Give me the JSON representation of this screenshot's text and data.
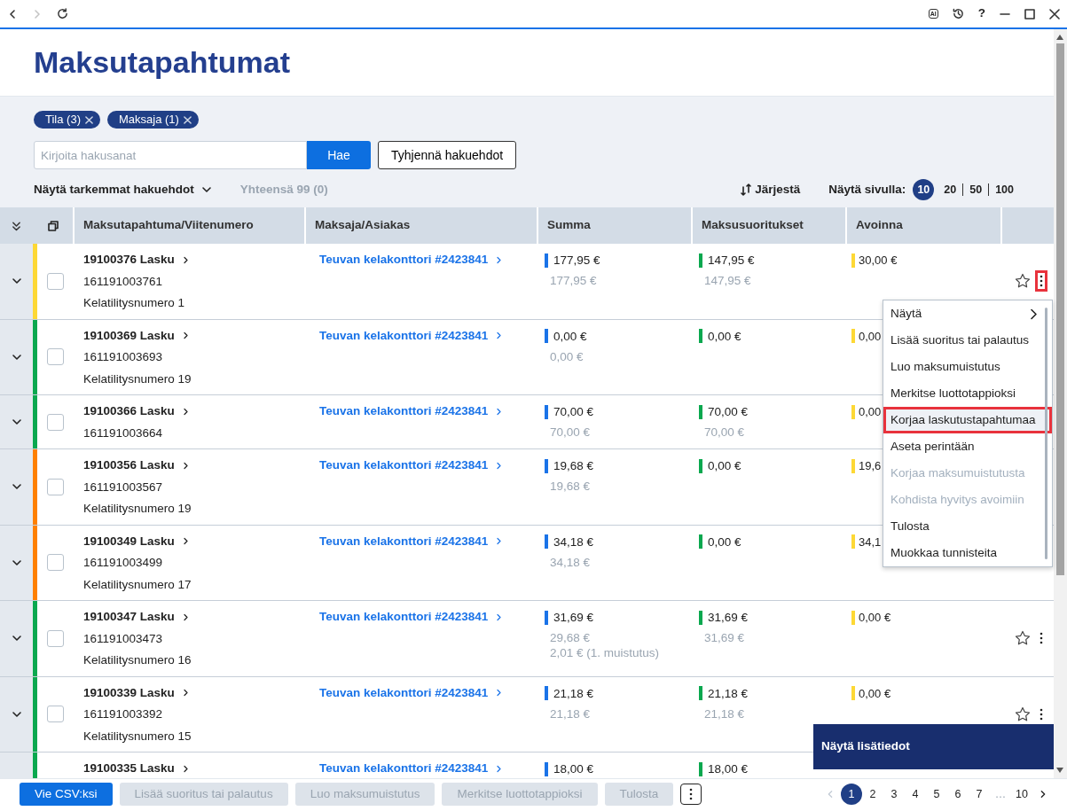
{
  "browser": {
    "ai_label": "AI",
    "help_label": "?"
  },
  "title": "Maksutapahtumat",
  "filters": [
    {
      "label": "Tila (3)"
    },
    {
      "label": "Maksaja (1)"
    }
  ],
  "search": {
    "placeholder": "Kirjoita hakusanat",
    "button": "Hae",
    "clear": "Tyhjennä hakuehdot"
  },
  "advanced": "Näytä tarkemmat hakuehdot",
  "total": "Yhteensä 99 (0)",
  "sort": "Järjestä",
  "per_page": {
    "label": "Näytä sivulla:",
    "options": [
      {
        "label": "10",
        "selected": true
      },
      {
        "label": "20",
        "selected": false
      },
      {
        "label": "50",
        "selected": false
      },
      {
        "label": "100",
        "selected": false
      }
    ]
  },
  "table": {
    "columns": [
      "Maksutapahtuma/Viitenumero",
      "Maksaja/Asiakas",
      "Summa",
      "Maksusuoritukset",
      "Avoinna"
    ],
    "rows": [
      {
        "invoice": "19100376 Lasku",
        "reference": "161191003761",
        "note": "Kelatilitysnumero 1",
        "color": "#fdd835",
        "checked": false,
        "customer": "Teuvan kelakonttori #2423841",
        "amount": "177,95 €",
        "amount_details": [
          "177,95 €"
        ],
        "payments": "147,95 €",
        "payment_details": [
          "147,95 €"
        ],
        "open": "30,00 €",
        "actions_visible": true,
        "menu_highlighted": true
      },
      {
        "invoice": "19100369 Lasku",
        "reference": "161191003693",
        "note": "Kelatilitysnumero 19",
        "color": "#0aa84f",
        "checked": false,
        "customer": "Teuvan kelakonttori #2423841",
        "amount": "0,00 €",
        "amount_details": [
          "0,00 €"
        ],
        "payments": "0,00 €",
        "payment_details": [],
        "open": "0,00",
        "actions_visible": false
      },
      {
        "invoice": "19100366 Lasku",
        "reference": "161191003664",
        "color": "#0aa84f",
        "checked": false,
        "customer": "Teuvan kelakonttori #2423841",
        "amount": "70,00 €",
        "amount_details": [
          "70,00 €"
        ],
        "payments": "70,00 €",
        "payment_details": [
          "70,00 €"
        ],
        "open": "0,00",
        "actions_visible": false
      },
      {
        "invoice": "19100356 Lasku",
        "reference": "161191003567",
        "note": "Kelatilitysnumero 19",
        "color": "#ff8000",
        "checked": false,
        "customer": "Teuvan kelakonttori #2423841",
        "amount": "19,68 €",
        "amount_details": [
          "19,68 €"
        ],
        "payments": "0,00 €",
        "payment_details": [],
        "open": "19,6",
        "actions_visible": false
      },
      {
        "invoice": "19100349 Lasku",
        "reference": "161191003499",
        "note": "Kelatilitysnumero 17",
        "color": "#ff8000",
        "checked": false,
        "customer": "Teuvan kelakonttori #2423841",
        "amount": "34,18 €",
        "amount_details": [
          "34,18 €"
        ],
        "payments": "0,00 €",
        "payment_details": [],
        "open": "34,1",
        "actions_visible": false
      },
      {
        "invoice": "19100347 Lasku",
        "reference": "161191003473",
        "note": "Kelatilitysnumero 16",
        "color": "#0aa84f",
        "checked": false,
        "customer": "Teuvan kelakonttori #2423841",
        "amount": "31,69 €",
        "amount_details": [
          "29,68 €",
          "2,01 € (1. muistutus)"
        ],
        "payments": "31,69 €",
        "payment_details": [
          "31,69 €"
        ],
        "open": "0,00 €",
        "actions_visible": true,
        "menu_highlighted": false
      },
      {
        "invoice": "19100339 Lasku",
        "reference": "161191003392",
        "note": "Kelatilitysnumero 15",
        "color": "#0aa84f",
        "checked": false,
        "customer": "Teuvan kelakonttori #2423841",
        "amount": "21,18 €",
        "amount_details": [
          "21,18 €"
        ],
        "payments": "21,18 €",
        "payment_details": [
          "21,18 €"
        ],
        "open": "0,00 €",
        "actions_visible": true,
        "menu_highlighted": false
      },
      {
        "invoice": "19100335 Lasku",
        "color": "#0aa84f",
        "customer": "Teuvan kelakonttori #2423841",
        "amount": "18,00 €",
        "amount_details": [],
        "payments": "18,00 €",
        "payment_details": [],
        "actions_visible": false
      }
    ]
  },
  "menu": {
    "items": [
      {
        "label": "Näytä",
        "submenu": true,
        "disabled": false,
        "highlighted": false
      },
      {
        "label": "Lisää suoritus tai palautus",
        "submenu": false,
        "disabled": false,
        "highlighted": false
      },
      {
        "label": "Luo maksumuistutus",
        "submenu": false,
        "disabled": false,
        "highlighted": false
      },
      {
        "label": "Merkitse luottotappioksi",
        "submenu": false,
        "disabled": false,
        "highlighted": false
      },
      {
        "label": "Korjaa laskutustapahtumaa",
        "submenu": false,
        "disabled": false,
        "highlighted": true
      },
      {
        "label": "Aseta perintään",
        "submenu": false,
        "disabled": false,
        "highlighted": false
      },
      {
        "label": "Korjaa maksumuistutusta",
        "submenu": false,
        "disabled": true,
        "highlighted": false
      },
      {
        "label": "Kohdista hyvitys avoimiin",
        "submenu": false,
        "disabled": true,
        "highlighted": false
      },
      {
        "label": "Tulosta",
        "submenu": false,
        "disabled": false,
        "highlighted": false
      },
      {
        "label": "Muokkaa tunnisteita",
        "submenu": false,
        "disabled": false,
        "highlighted": false
      }
    ]
  },
  "details_popup": "Näytä lisätiedot",
  "bottom": {
    "buttons": [
      {
        "label": "Vie CSV:ksi",
        "disabled": false
      },
      {
        "label": "Lisää suoritus tai palautus",
        "disabled": true
      },
      {
        "label": "Luo maksumuistutus",
        "disabled": true
      },
      {
        "label": "Merkitse luottotappioksi",
        "disabled": true
      },
      {
        "label": "Tulosta",
        "disabled": true
      }
    ],
    "prev_disabled": true,
    "pages": [
      {
        "label": "1",
        "selected": true
      },
      {
        "label": "2",
        "selected": false
      },
      {
        "label": "3",
        "selected": false
      },
      {
        "label": "4",
        "selected": false
      },
      {
        "label": "5",
        "selected": false
      },
      {
        "label": "6",
        "selected": false
      },
      {
        "label": "7",
        "selected": false
      },
      {
        "label": "…",
        "selected": false
      },
      {
        "label": "10",
        "selected": false
      }
    ]
  }
}
